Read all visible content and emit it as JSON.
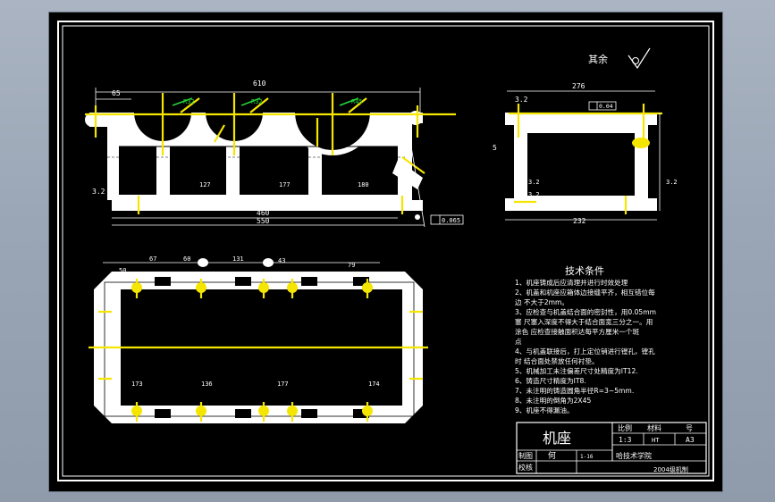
{
  "drawing": {
    "surface_finish": "其余",
    "front_view": {
      "dims": [
        "65",
        "610",
        "R32",
        "R32",
        "R45",
        "460",
        "550",
        "127",
        "177",
        "180",
        "3.2",
        "0.065"
      ]
    },
    "side_view": {
      "dims": [
        "276",
        "3.2",
        "0.04",
        "5",
        "3.2",
        "3.2",
        "3.2",
        "232"
      ]
    },
    "plan_view": {
      "dims": [
        "50",
        "67",
        "60",
        "131",
        "43",
        "79",
        "173",
        "136",
        "177",
        "174"
      ]
    },
    "tech_requirements": {
      "title": "技术条件",
      "lines": [
        "1、机座铸成后应清理并进行时效处理",
        "2、机盖和机座应箱体边接缝平齐，相互错位每",
        "边   不大于2mm。",
        "3、应检查与机盖结合面的密封性，用0.05mm",
        "塞   尺塞入深度不得大于结合面宽三分之一。用",
        "涂色       应检查接触面积达每平方厘米一个斑",
        "点",
        "4、与机盖联接后，打上定位销进行镗孔，镗孔",
        "时    结合面处禁放任何衬垫。",
        "5、机械加工未注偏差尺寸处精度为IT12.",
        "6、铸造尺寸精度为IT8.",
        "7、未注明的铸造圆角半径R=3~5mm.",
        "8、未注明的倒角为2X45",
        "9、机座不得漏油。"
      ]
    },
    "title_block": {
      "name": "机座",
      "scale_label": "比例",
      "material_label": "材料",
      "sheet_label": "号",
      "scale_value": "1:3",
      "material_value": "HT",
      "sheet_value": "A3",
      "drawn_label": "制图",
      "checked_label": "校核",
      "drawn_name": "何",
      "date": "1-16",
      "school": "哈技术学院",
      "footer": "2004级机制"
    }
  }
}
